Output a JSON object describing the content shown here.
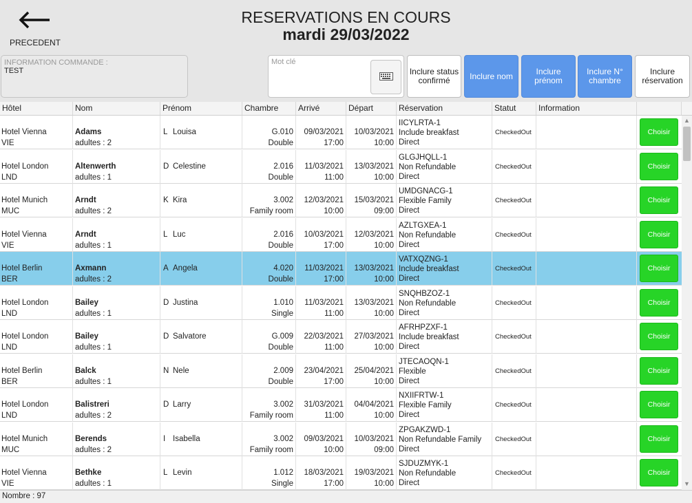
{
  "header": {
    "back_label": "PRECEDENT",
    "title": "RESERVATIONS EN COURS",
    "date": "mardi 29/03/2022"
  },
  "filters": {
    "info_label": "INFORMATION COMMANDE :",
    "info_value": "TEST",
    "keyword_placeholder": "Mot clé",
    "buttons": [
      {
        "label": "Inclure status\nconfirmé",
        "active": false
      },
      {
        "label": "Inclure nom",
        "active": true
      },
      {
        "label": "Inclure\nprénom",
        "active": true
      },
      {
        "label": "Inclure N°\nchambre",
        "active": true
      },
      {
        "label": "Inclure\nréservation",
        "active": false
      }
    ]
  },
  "table": {
    "columns": [
      "Hôtel",
      "Nom",
      "Prénom",
      "Chambre",
      "Arrivé",
      "Départ",
      "Réservation",
      "Statut",
      "Information"
    ],
    "choose_label": "Choisir",
    "rows": [
      {
        "hotel": "Hotel Vienna",
        "code": "VIE",
        "name": "Adams",
        "adults": "adultes : 2",
        "initial": "L",
        "firstname": "Louisa",
        "room": "G.010",
        "roomtype": "Double",
        "arrive_date": "09/03/2021",
        "arrive_time": "17:00",
        "depart_date": "10/03/2021",
        "depart_time": "10:00",
        "res_id": "IICYLRTA-1",
        "res_rate": "Include breakfast",
        "res_channel": "Direct",
        "status": "CheckedOut",
        "selected": false
      },
      {
        "hotel": "Hotel London",
        "code": "LND",
        "name": "Altenwerth",
        "adults": "adultes : 1",
        "initial": "D",
        "firstname": "Celestine",
        "room": "2.016",
        "roomtype": "Double",
        "arrive_date": "11/03/2021",
        "arrive_time": "11:00",
        "depart_date": "13/03/2021",
        "depart_time": "10:00",
        "res_id": "GLGJHQLL-1",
        "res_rate": "Non Refundable",
        "res_channel": "Direct",
        "status": "CheckedOut",
        "selected": false
      },
      {
        "hotel": "Hotel Munich",
        "code": "MUC",
        "name": "Arndt",
        "adults": "adultes : 2",
        "initial": "K",
        "firstname": "Kira",
        "room": "3.002",
        "roomtype": "Family room",
        "arrive_date": "12/03/2021",
        "arrive_time": "10:00",
        "depart_date": "15/03/2021",
        "depart_time": "09:00",
        "res_id": "UMDGNACG-1",
        "res_rate": "Flexible Family",
        "res_channel": "Direct",
        "status": "CheckedOut",
        "selected": false
      },
      {
        "hotel": "Hotel Vienna",
        "code": "VIE",
        "name": "Arndt",
        "adults": "adultes : 1",
        "initial": "L",
        "firstname": "Luc",
        "room": "2.016",
        "roomtype": "Double",
        "arrive_date": "10/03/2021",
        "arrive_time": "17:00",
        "depart_date": "12/03/2021",
        "depart_time": "10:00",
        "res_id": "AZLTGXEA-1",
        "res_rate": "Non Refundable",
        "res_channel": "Direct",
        "status": "CheckedOut",
        "selected": false
      },
      {
        "hotel": "Hotel Berlin",
        "code": "BER",
        "name": "Axmann",
        "adults": "adultes : 2",
        "initial": "A",
        "firstname": "Angela",
        "room": "4.020",
        "roomtype": "Double",
        "arrive_date": "11/03/2021",
        "arrive_time": "17:00",
        "depart_date": "13/03/2021",
        "depart_time": "10:00",
        "res_id": "VATXQZNG-1",
        "res_rate": "Include breakfast",
        "res_channel": "Direct",
        "status": "CheckedOut",
        "selected": true
      },
      {
        "hotel": "Hotel London",
        "code": "LND",
        "name": "Bailey",
        "adults": "adultes : 1",
        "initial": "D",
        "firstname": "Justina",
        "room": "1.010",
        "roomtype": "Single",
        "arrive_date": "11/03/2021",
        "arrive_time": "11:00",
        "depart_date": "13/03/2021",
        "depart_time": "10:00",
        "res_id": "SNQHBZOZ-1",
        "res_rate": "Non Refundable",
        "res_channel": "Direct",
        "status": "CheckedOut",
        "selected": false
      },
      {
        "hotel": "Hotel London",
        "code": "LND",
        "name": "Bailey",
        "adults": "adultes : 1",
        "initial": "D",
        "firstname": "Salvatore",
        "room": "G.009",
        "roomtype": "Double",
        "arrive_date": "22/03/2021",
        "arrive_time": "11:00",
        "depart_date": "27/03/2021",
        "depart_time": "10:00",
        "res_id": "AFRHPZXF-1",
        "res_rate": "Include breakfast",
        "res_channel": "Direct",
        "status": "CheckedOut",
        "selected": false
      },
      {
        "hotel": "Hotel Berlin",
        "code": "BER",
        "name": "Balck",
        "adults": "adultes : 1",
        "initial": "N",
        "firstname": "Nele",
        "room": "2.009",
        "roomtype": "Double",
        "arrive_date": "23/04/2021",
        "arrive_time": "17:00",
        "depart_date": "25/04/2021",
        "depart_time": "10:00",
        "res_id": "JTECAOQN-1",
        "res_rate": "Flexible",
        "res_channel": "Direct",
        "status": "CheckedOut",
        "selected": false
      },
      {
        "hotel": "Hotel London",
        "code": "LND",
        "name": "Balistreri",
        "adults": "adultes : 2",
        "initial": "D",
        "firstname": "Larry",
        "room": "3.002",
        "roomtype": "Family room",
        "arrive_date": "31/03/2021",
        "arrive_time": "11:00",
        "depart_date": "04/04/2021",
        "depart_time": "10:00",
        "res_id": "NXIIFRTW-1",
        "res_rate": "Flexible Family",
        "res_channel": "Direct",
        "status": "CheckedOut",
        "selected": false
      },
      {
        "hotel": "Hotel Munich",
        "code": "MUC",
        "name": "Berends",
        "adults": "adultes : 2",
        "initial": "I",
        "firstname": "Isabella",
        "room": "3.002",
        "roomtype": "Family room",
        "arrive_date": "09/03/2021",
        "arrive_time": "10:00",
        "depart_date": "10/03/2021",
        "depart_time": "09:00",
        "res_id": "ZPGAKZWD-1",
        "res_rate": "Non Refundable Family",
        "res_channel": "Direct",
        "status": "CheckedOut",
        "selected": false
      },
      {
        "hotel": "Hotel Vienna",
        "code": "VIE",
        "name": "Bethke",
        "adults": "adultes : 1",
        "initial": "L",
        "firstname": "Levin",
        "room": "1.012",
        "roomtype": "Single",
        "arrive_date": "18/03/2021",
        "arrive_time": "17:00",
        "depart_date": "19/03/2021",
        "depart_time": "10:00",
        "res_id": "SJDUZMYK-1",
        "res_rate": "Non Refundable",
        "res_channel": "Direct",
        "status": "CheckedOut",
        "selected": false
      }
    ]
  },
  "footer": {
    "count": "Nombre : 97"
  }
}
